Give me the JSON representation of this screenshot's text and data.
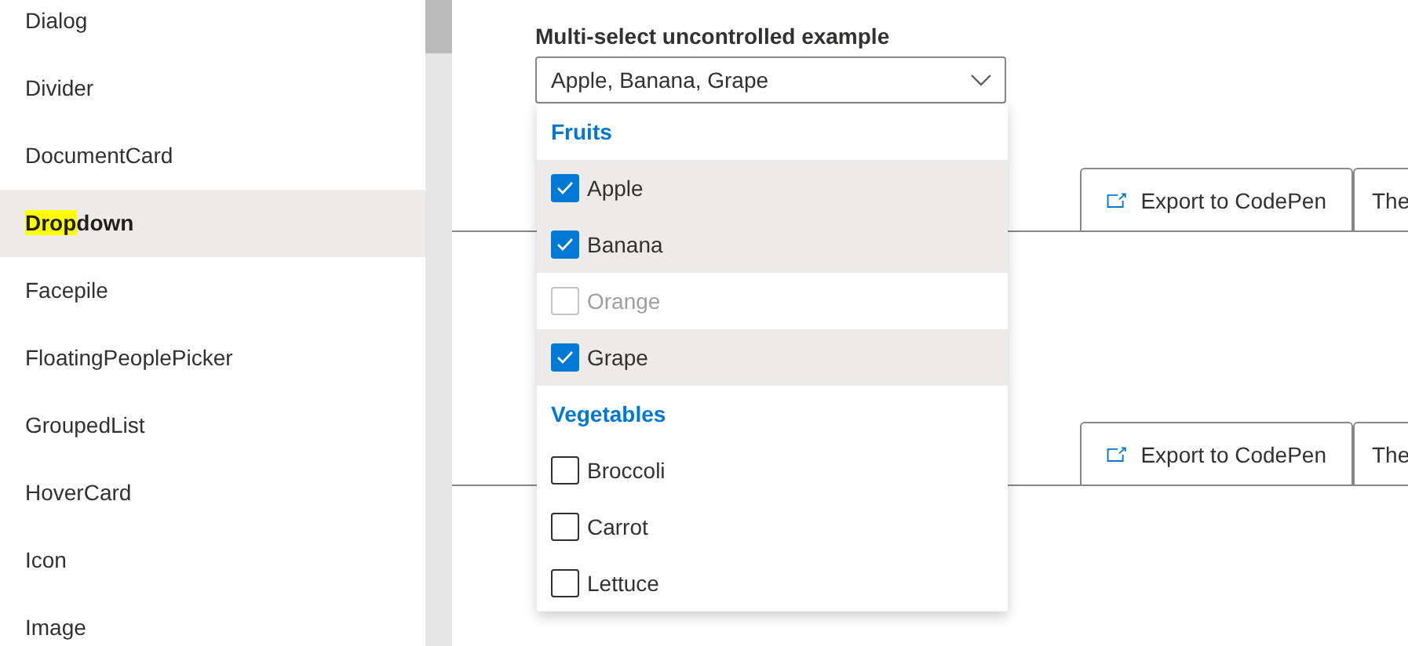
{
  "sidebar": {
    "items": [
      {
        "label_parts": [
          {
            "text": "Dialog",
            "highlighted": false
          }
        ],
        "selected": false
      },
      {
        "label_parts": [
          {
            "text": "Divider",
            "highlighted": false
          }
        ],
        "selected": false
      },
      {
        "label_parts": [
          {
            "text": "DocumentCard",
            "highlighted": false
          }
        ],
        "selected": false
      },
      {
        "label_parts": [
          {
            "text": "Drop",
            "highlighted": true
          },
          {
            "text": "down",
            "highlighted": false
          }
        ],
        "selected": true
      },
      {
        "label_parts": [
          {
            "text": "Facepile",
            "highlighted": false
          }
        ],
        "selected": false
      },
      {
        "label_parts": [
          {
            "text": "FloatingPeoplePicker",
            "highlighted": false
          }
        ],
        "selected": false
      },
      {
        "label_parts": [
          {
            "text": "GroupedList",
            "highlighted": false
          }
        ],
        "selected": false
      },
      {
        "label_parts": [
          {
            "text": "HoverCard",
            "highlighted": false
          }
        ],
        "selected": false
      },
      {
        "label_parts": [
          {
            "text": "Icon",
            "highlighted": false
          }
        ],
        "selected": false
      },
      {
        "label_parts": [
          {
            "text": "Image",
            "highlighted": false
          }
        ],
        "selected": false
      }
    ]
  },
  "dropdown": {
    "label": "Multi-select uncontrolled example",
    "value": "Apple, Banana, Grape",
    "expanded": true,
    "options": [
      {
        "kind": "header",
        "text": "Fruits"
      },
      {
        "kind": "option",
        "text": "Apple",
        "checked": true,
        "disabled": false
      },
      {
        "kind": "option",
        "text": "Banana",
        "checked": true,
        "disabled": false
      },
      {
        "kind": "option",
        "text": "Orange",
        "checked": false,
        "disabled": true
      },
      {
        "kind": "option",
        "text": "Grape",
        "checked": true,
        "disabled": false
      },
      {
        "kind": "header",
        "text": "Vegetables"
      },
      {
        "kind": "option",
        "text": "Broccoli",
        "checked": false,
        "disabled": false
      },
      {
        "kind": "option",
        "text": "Carrot",
        "checked": false,
        "disabled": false
      },
      {
        "kind": "option",
        "text": "Lettuce",
        "checked": false,
        "disabled": false
      }
    ]
  },
  "example_toolbars": [
    {
      "buttons": [
        "Export to CodePen",
        "The"
      ]
    },
    {
      "buttons": [
        "Export to CodePen",
        "The"
      ]
    }
  ]
}
